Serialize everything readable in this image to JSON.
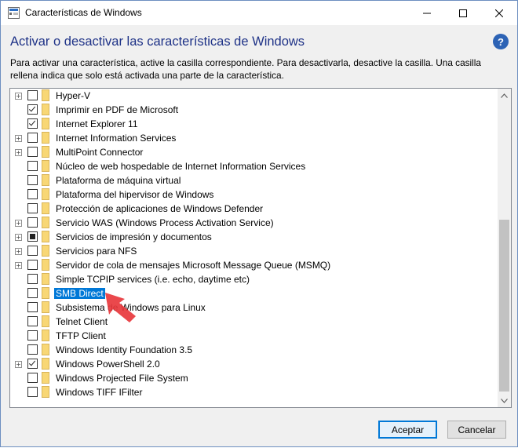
{
  "window": {
    "title": "Características de Windows",
    "controls": [
      "minimize",
      "maximize",
      "close"
    ]
  },
  "heading": "Activar o desactivar las características de Windows",
  "description": "Para activar una característica, active la casilla correspondiente. Para desactivarla, desactive la casilla. Una casilla rellena indica que solo está activada una parte de la característica.",
  "features": [
    {
      "label": "Hyper-V",
      "state": "unchecked",
      "expandable": true
    },
    {
      "label": "Imprimir en PDF de Microsoft",
      "state": "checked",
      "expandable": false
    },
    {
      "label": "Internet Explorer 11",
      "state": "checked",
      "expandable": false
    },
    {
      "label": "Internet Information Services",
      "state": "unchecked",
      "expandable": true
    },
    {
      "label": "MultiPoint Connector",
      "state": "unchecked",
      "expandable": true
    },
    {
      "label": "Núcleo de web hospedable de Internet Information Services",
      "state": "unchecked",
      "expandable": false
    },
    {
      "label": "Plataforma de máquina virtual",
      "state": "unchecked",
      "expandable": false
    },
    {
      "label": "Plataforma del hipervisor de Windows",
      "state": "unchecked",
      "expandable": false
    },
    {
      "label": "Protección de aplicaciones de Windows Defender",
      "state": "unchecked",
      "expandable": false
    },
    {
      "label": "Servicio WAS (Windows Process Activation Service)",
      "state": "unchecked",
      "expandable": true
    },
    {
      "label": "Servicios de impresión y documentos",
      "state": "partial",
      "expandable": true
    },
    {
      "label": "Servicios para NFS",
      "state": "unchecked",
      "expandable": true
    },
    {
      "label": "Servidor de cola de mensajes Microsoft Message Queue (MSMQ)",
      "state": "unchecked",
      "expandable": true
    },
    {
      "label": "Simple TCPIP services (i.e. echo, daytime etc)",
      "state": "unchecked",
      "expandable": false
    },
    {
      "label": "SMB Direct",
      "state": "unchecked",
      "expandable": false,
      "selected": true
    },
    {
      "label": "Subsistema de Windows para Linux",
      "state": "unchecked",
      "expandable": false
    },
    {
      "label": "Telnet Client",
      "state": "unchecked",
      "expandable": false
    },
    {
      "label": "TFTP Client",
      "state": "unchecked",
      "expandable": false
    },
    {
      "label": "Windows Identity Foundation 3.5",
      "state": "unchecked",
      "expandable": false
    },
    {
      "label": "Windows PowerShell 2.0",
      "state": "checked",
      "expandable": true
    },
    {
      "label": "Windows Projected File System",
      "state": "unchecked",
      "expandable": false
    },
    {
      "label": "Windows TIFF IFilter",
      "state": "unchecked",
      "expandable": false
    }
  ],
  "buttons": {
    "accept": "Aceptar",
    "cancel": "Cancelar"
  },
  "colors": {
    "heading": "#1e3287",
    "selection": "#0078d7",
    "folder": "#f8d775",
    "annotation_arrow": "#e8383d"
  }
}
